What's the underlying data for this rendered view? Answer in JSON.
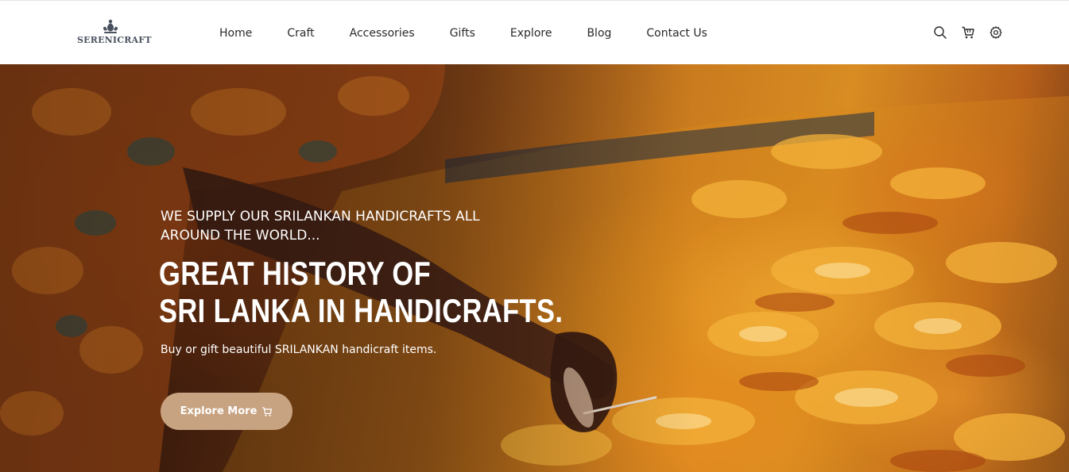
{
  "brand": {
    "logo_text": "SERENICRAFT"
  },
  "nav": {
    "items": [
      {
        "label": "Home"
      },
      {
        "label": "Craft"
      },
      {
        "label": "Accessories"
      },
      {
        "label": "Gifts"
      },
      {
        "label": "Explore"
      },
      {
        "label": "Blog"
      },
      {
        "label": "Contact Us"
      }
    ]
  },
  "header_icons": [
    "search-icon",
    "cart-icon",
    "settings-gear-icon"
  ],
  "hero": {
    "tagline": "WE SUPPLY OUR SRILANKAN HANDICRAFTS ALL AROUND THE WORLD...",
    "headline_line1": "GREAT HISTORY OF",
    "headline_line2": "SRI LANKA IN HANDICRAFTS.",
    "subtext": "Buy or gift beautiful SRILANKAN handicraft items.",
    "cta_label": "Explore More",
    "cta_icon": "cart-icon"
  },
  "colors": {
    "accent": "#c7a382",
    "nav_text": "#2a2a2a",
    "logo": "#4a5260",
    "hero_text": "#ffffff"
  }
}
